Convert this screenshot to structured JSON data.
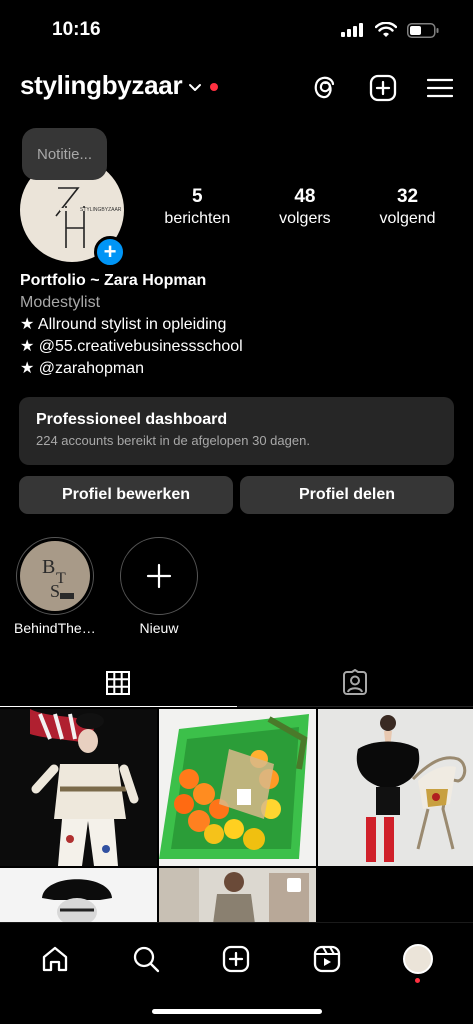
{
  "status_bar": {
    "time": "10:16"
  },
  "header": {
    "username": "stylingbyzaar"
  },
  "note": {
    "text": "Notitie..."
  },
  "stats": [
    {
      "value": "5",
      "label": "berichten"
    },
    {
      "value": "48",
      "label": "volgers"
    },
    {
      "value": "32",
      "label": "volgend"
    }
  ],
  "bio": {
    "name": "Portfolio ~ Zara Hopman",
    "category": "Modestylist",
    "lines": [
      "★ Allround stylist in opleiding",
      "★ @55.creativebusinessschool",
      "★ @zarahopman"
    ]
  },
  "dashboard": {
    "title": "Professioneel dashboard",
    "subtitle": "224 accounts bereikt in de afgelopen 30 dagen."
  },
  "buttons": {
    "edit": "Profiel bewerken",
    "share": "Profiel delen"
  },
  "highlights": [
    {
      "label": "BehindTheSc..."
    },
    {
      "label": "Nieuw"
    }
  ],
  "colors": {
    "accent": "#0095f6",
    "notification": "#ff3040",
    "card": "#262626"
  }
}
